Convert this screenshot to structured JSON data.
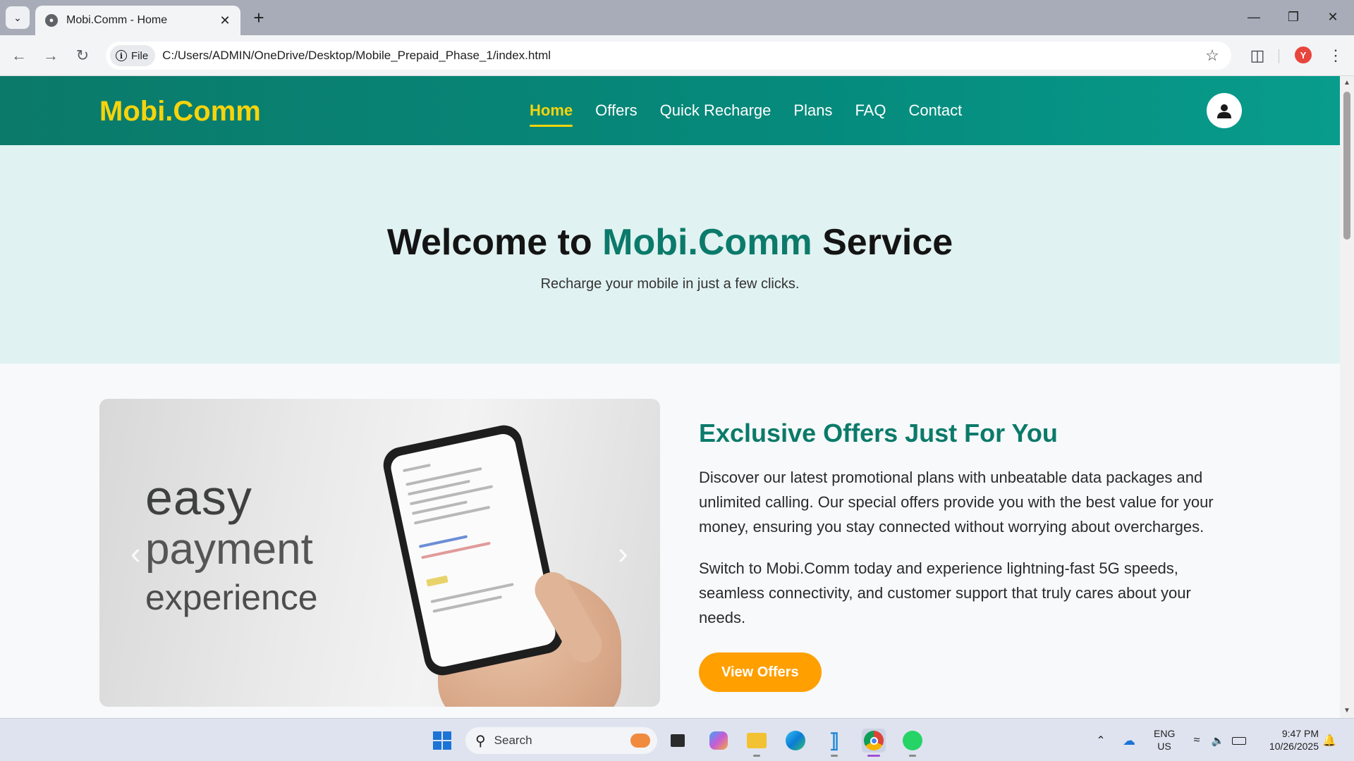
{
  "browser": {
    "tab_title": "Mobi.Comm - Home",
    "file_chip": "File",
    "url": "C:/Users/ADMIN/OneDrive/Desktop/Mobile_Prepaid_Phase_1/index.html",
    "profile_initial": "Y"
  },
  "site": {
    "logo": "Mobi.Comm",
    "nav": [
      "Home",
      "Offers",
      "Quick Recharge",
      "Plans",
      "FAQ",
      "Contact"
    ],
    "active_nav": "Home"
  },
  "hero": {
    "title_prefix": "Welcome to ",
    "title_brand": "Mobi.Comm",
    "title_suffix": " Service",
    "subtitle": "Recharge your mobile in just a few clicks."
  },
  "carousel": {
    "line1": "easy",
    "line2": "payment",
    "line3": "experience"
  },
  "offers": {
    "title": "Exclusive Offers Just For You",
    "p1": "Discover our latest promotional plans with unbeatable data packages and unlimited calling. Our special offers provide you with the best value for your money, ensuring you stay connected without worrying about overcharges.",
    "p2": "Switch to Mobi.Comm today and experience lightning-fast 5G speeds, seamless connectivity, and customer support that truly cares about your needs.",
    "button": "View Offers"
  },
  "taskbar": {
    "search_label": "Search",
    "lang_line1": "ENG",
    "lang_line2": "US",
    "time": "9:47 PM",
    "date": "10/26/2025"
  },
  "colors": {
    "brand_teal": "#0b7a6a",
    "logo_yellow": "#f6d40c",
    "cta_orange": "#ff9f00",
    "hero_bg": "#e0f2f1"
  }
}
